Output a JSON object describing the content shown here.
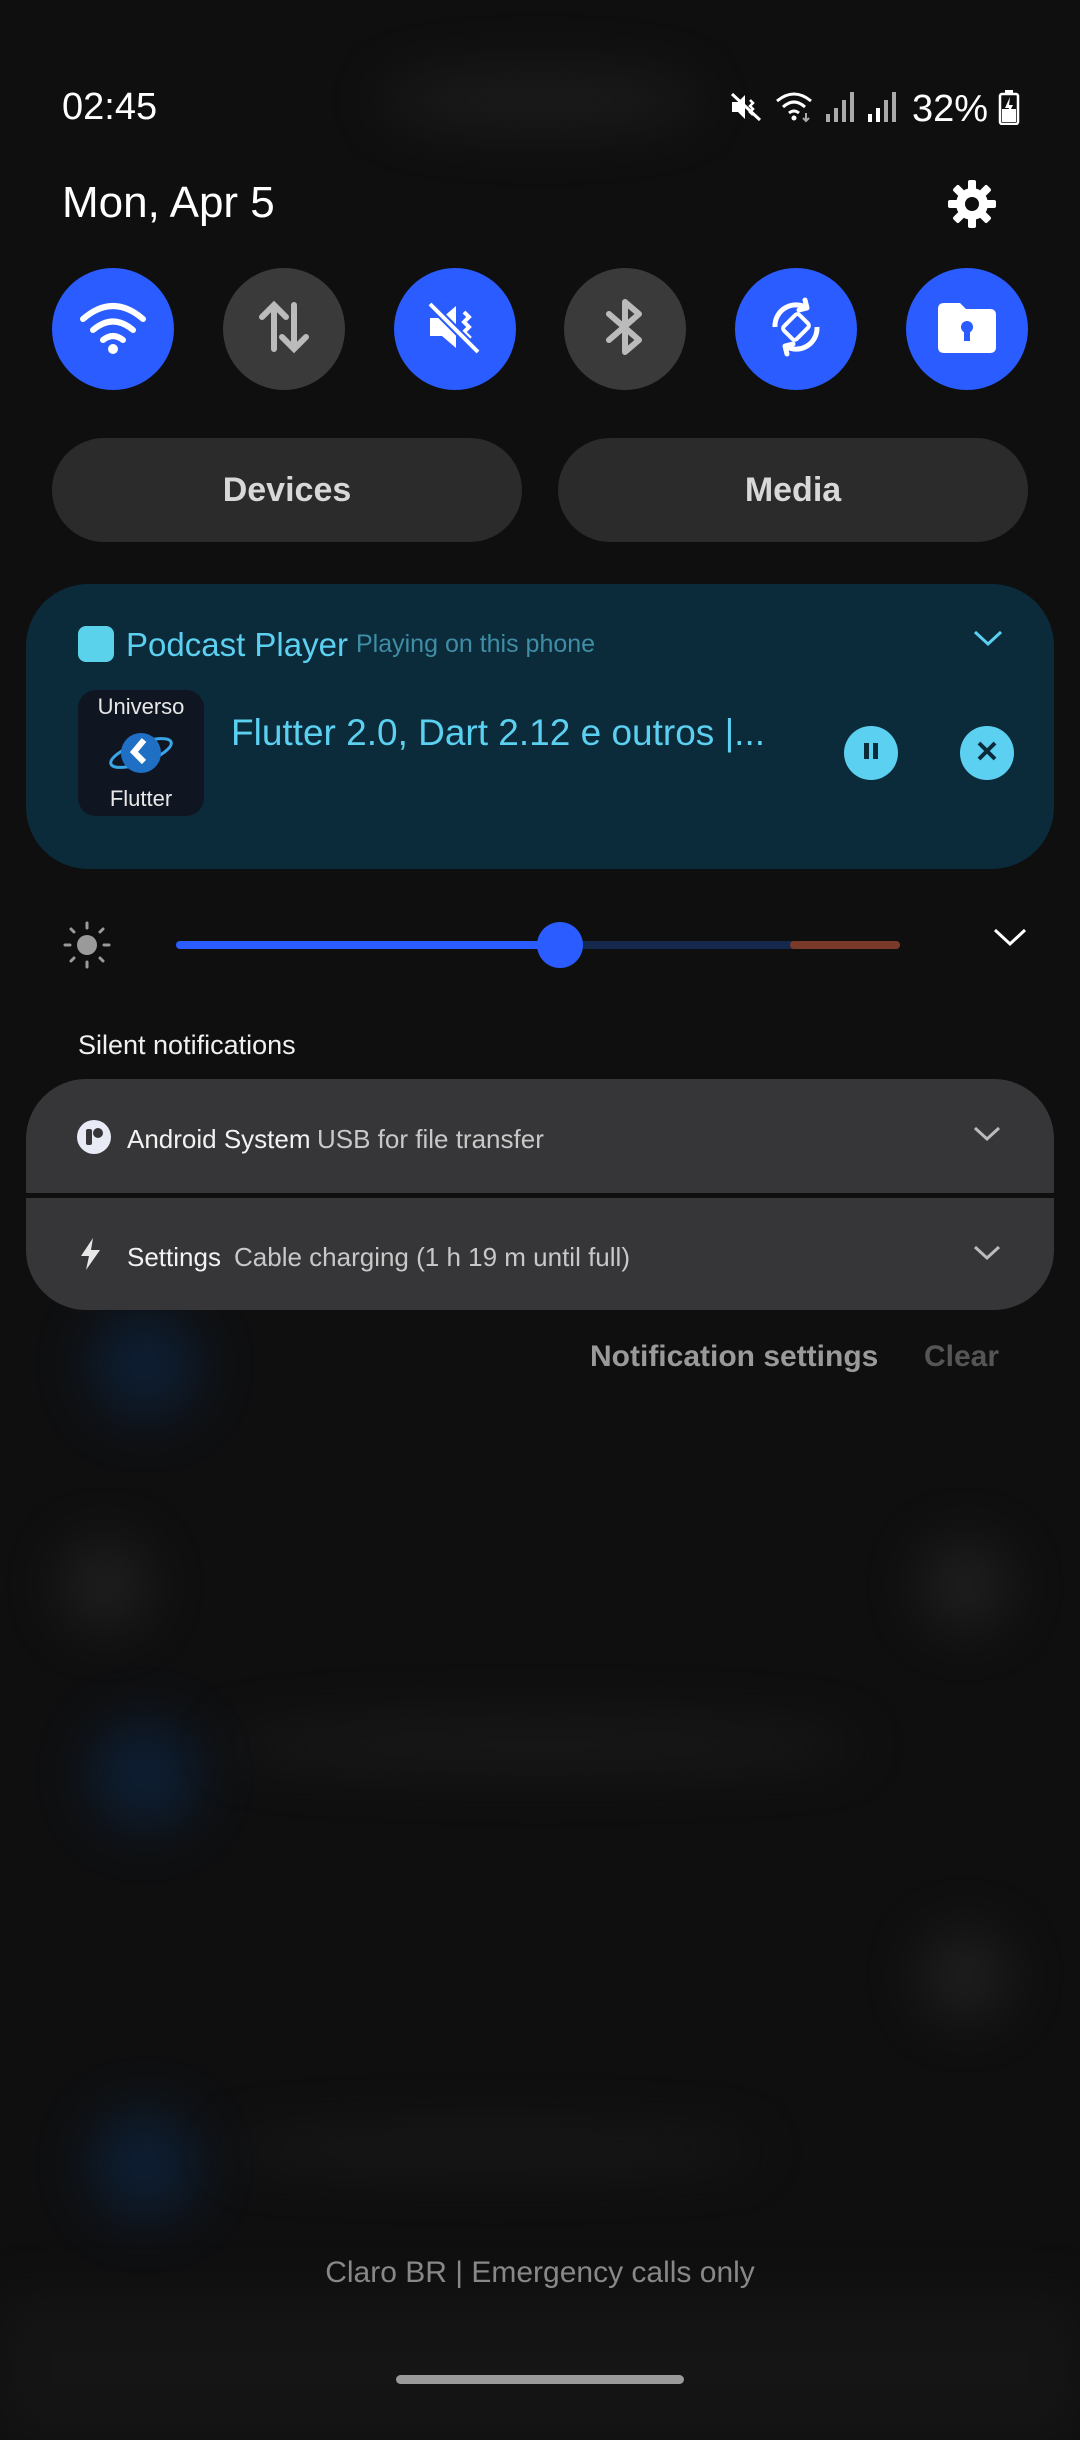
{
  "status_bar": {
    "time": "02:45",
    "battery_percent": "32%",
    "icons": [
      "vibrate-mute-icon",
      "wifi-icon",
      "signal-icon",
      "signal-icon",
      "battery-charging-icon"
    ]
  },
  "header": {
    "date": "Mon, Apr 5",
    "settings_icon": "gear-icon"
  },
  "quick_settings": [
    {
      "icon": "wifi-icon",
      "on": true
    },
    {
      "icon": "mobile-data-icon",
      "on": false
    },
    {
      "icon": "sound-off-icon",
      "on": true
    },
    {
      "icon": "bluetooth-icon",
      "on": false
    },
    {
      "icon": "auto-rotate-icon",
      "on": true
    },
    {
      "icon": "secure-folder-icon",
      "on": true
    }
  ],
  "pills": {
    "devices": "Devices",
    "media": "Media"
  },
  "media_player": {
    "app_name": "Podcast Player",
    "subtitle": "Playing on this phone",
    "title": "Flutter 2.0, Dart 2.12 e outros |...",
    "album_top": "Universo",
    "album_bottom": "Flutter",
    "accent": "#5cd0f0"
  },
  "brightness": {
    "level": 0.53,
    "accent": "#2a5cff"
  },
  "silent_notifications": {
    "label": "Silent notifications",
    "items": [
      {
        "app": "Android System",
        "text": "USB for file transfer",
        "icon": "android-system-icon"
      },
      {
        "app": "Settings",
        "text": "Cable charging (1 h 19 m until full)",
        "icon": "lightning-icon"
      }
    ]
  },
  "footer": {
    "notification_settings": "Notification settings",
    "clear": "Clear",
    "carrier": "Claro BR | Emergency calls only"
  }
}
